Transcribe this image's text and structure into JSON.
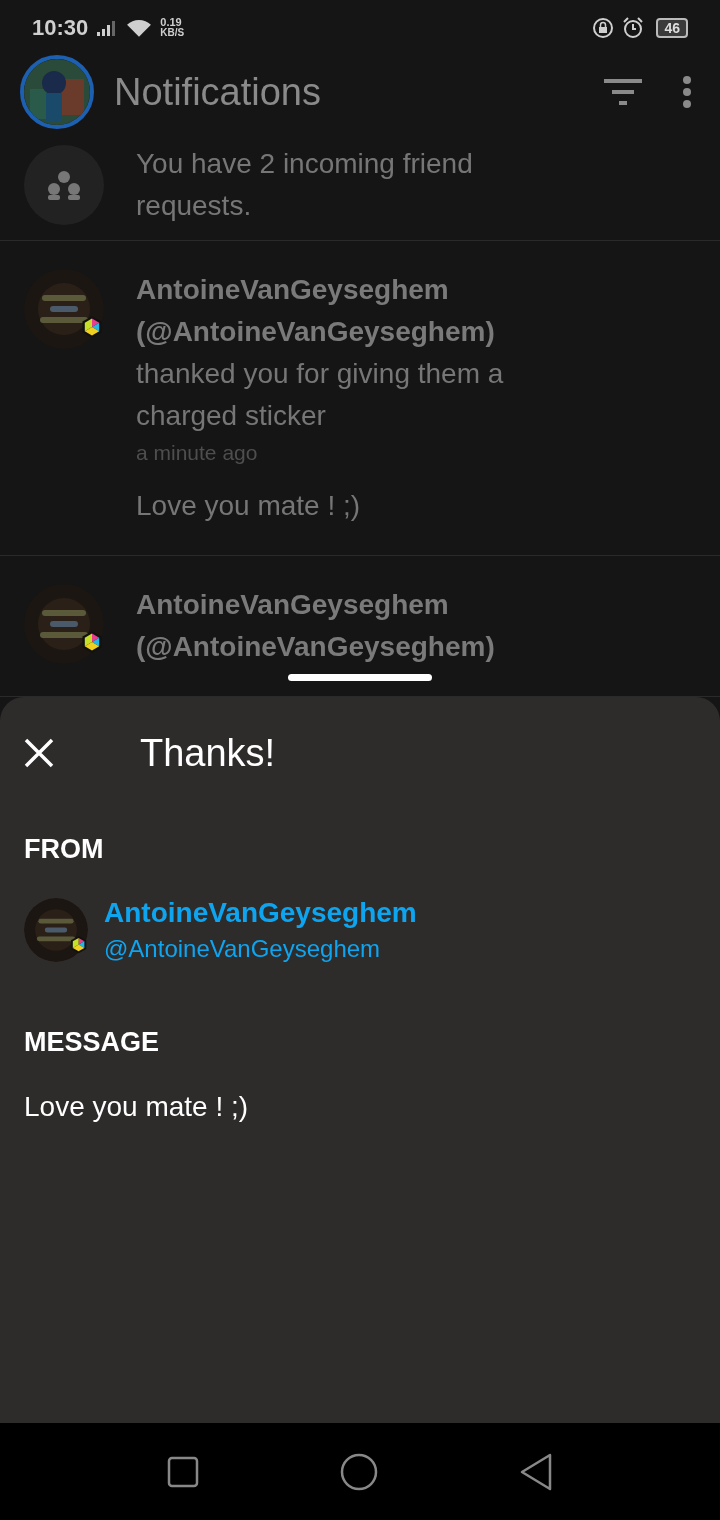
{
  "status_bar": {
    "time": "10:30",
    "speed_value": "0.19",
    "speed_unit": "KB/S",
    "battery": "46"
  },
  "header": {
    "title": "Notifications"
  },
  "friend_requests": {
    "text": "You have 2 incoming friend requests."
  },
  "notifications": [
    {
      "name": "AntoineVanGeyseghem",
      "handle": "(@AntoineVanGeyseghem)",
      "action": "thanked you for giving them a charged sticker",
      "time": "a minute ago",
      "message": "Love you mate ! ;)"
    },
    {
      "name": "AntoineVanGeyseghem",
      "handle": "(@AntoineVanGeyseghem)"
    }
  ],
  "sheet": {
    "title": "Thanks!",
    "from_label": "FROM",
    "sender_name": "AntoineVanGeyseghem",
    "sender_handle": "@AntoineVanGeyseghem",
    "message_label": "MESSAGE",
    "message": "Love you mate ! ;)"
  }
}
